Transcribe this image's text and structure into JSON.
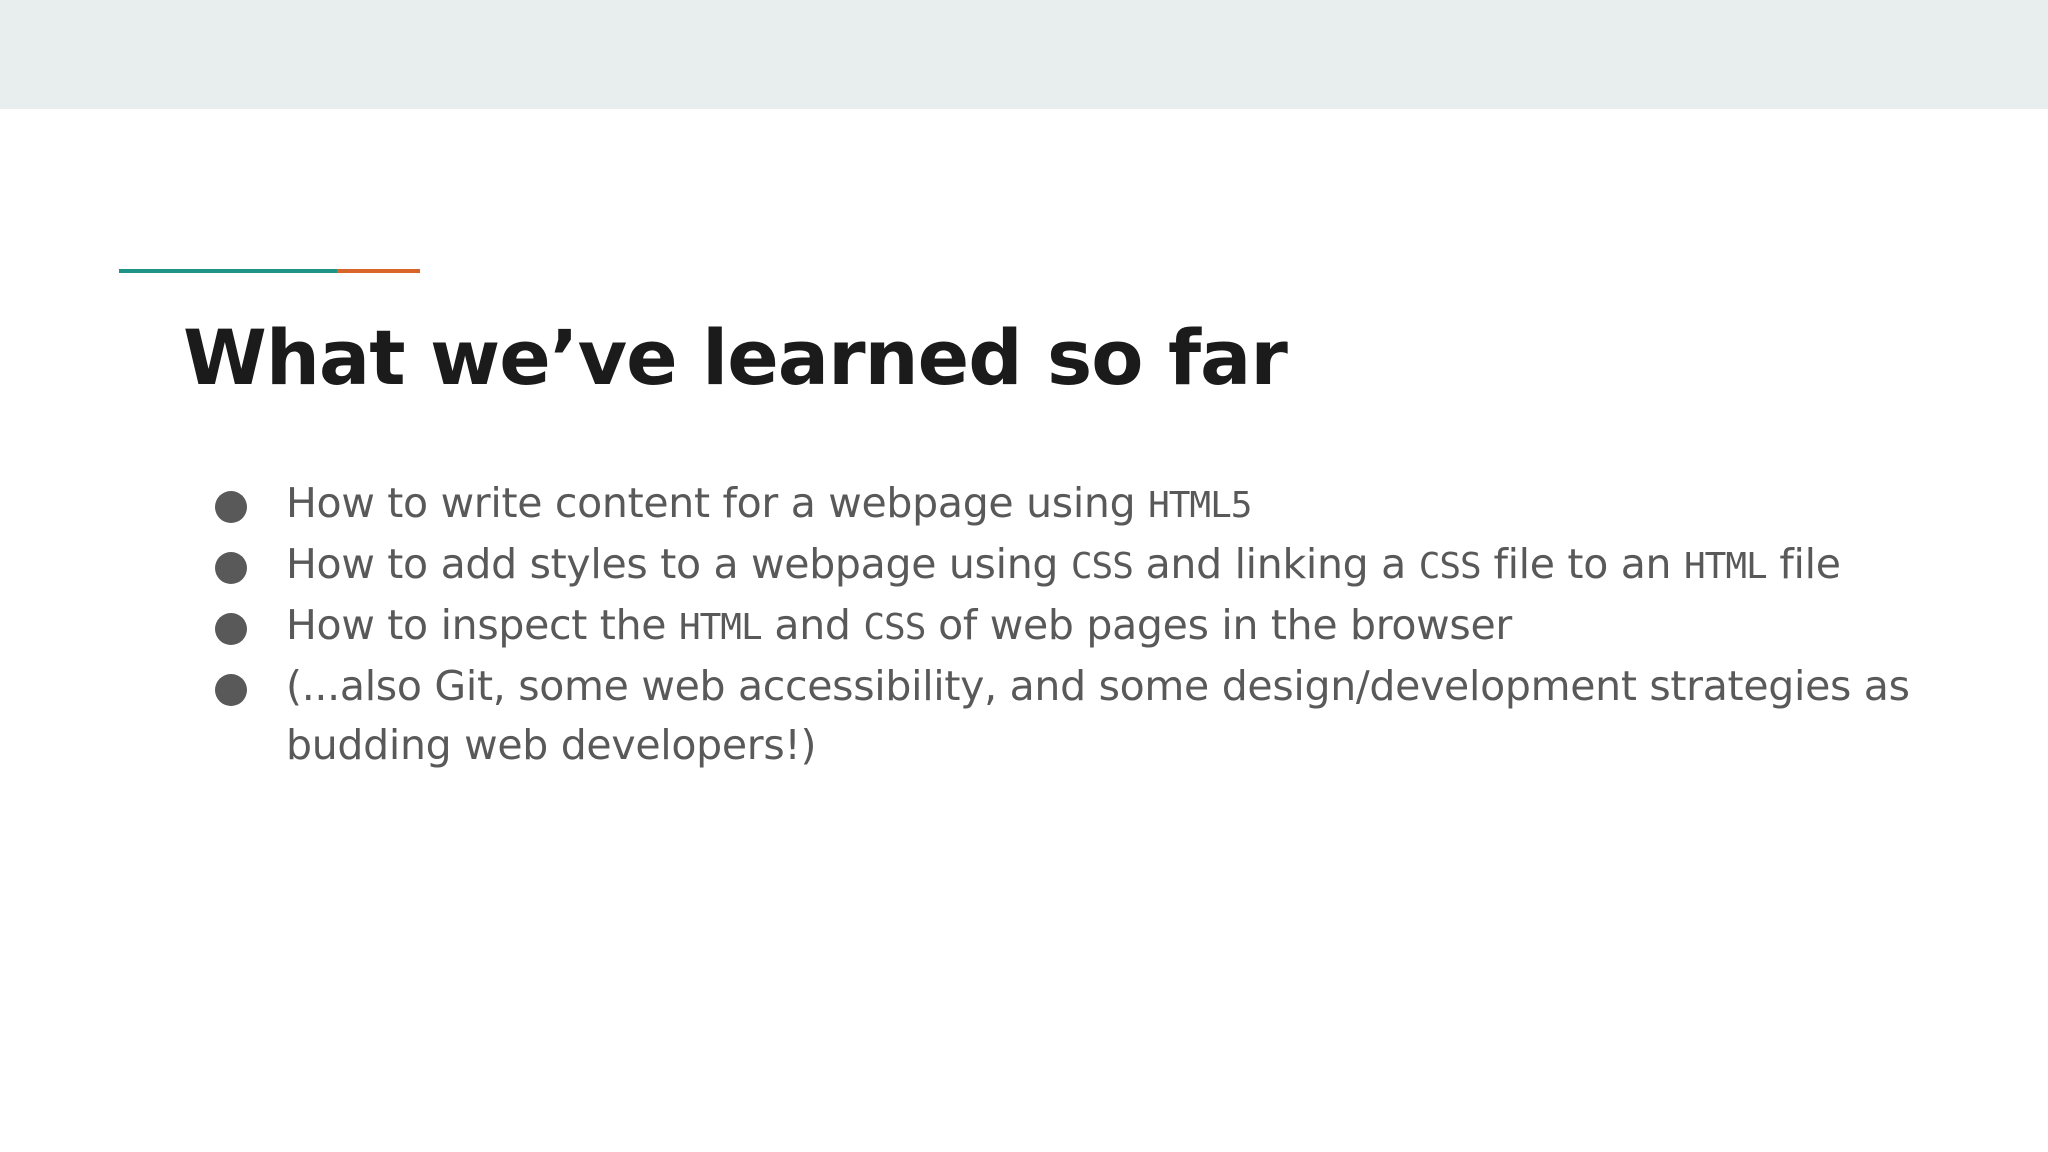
{
  "colors": {
    "top_band": "#e8eeee",
    "accent_teal": "#1e9488",
    "accent_orange": "#d9642a",
    "title": "#1b1b1b",
    "body_text": "#595959"
  },
  "slide": {
    "title": "What we’ve learned so far",
    "bullets": [
      {
        "parts": [
          {
            "text": "How to write content for a webpage using ",
            "code": false
          },
          {
            "text": "HTML5",
            "code": true
          }
        ]
      },
      {
        "parts": [
          {
            "text": "How to add styles to a webpage using ",
            "code": false
          },
          {
            "text": "CSS",
            "code": true
          },
          {
            "text": " and linking a ",
            "code": false
          },
          {
            "text": "CSS",
            "code": true
          },
          {
            "text": " file to an ",
            "code": false
          },
          {
            "text": "HTML",
            "code": true
          },
          {
            "text": " file",
            "code": false
          }
        ]
      },
      {
        "parts": [
          {
            "text": "How to inspect the ",
            "code": false
          },
          {
            "text": "HTML",
            "code": true
          },
          {
            "text": " and ",
            "code": false
          },
          {
            "text": "CSS",
            "code": true
          },
          {
            "text": " of web pages in the browser",
            "code": false
          }
        ]
      },
      {
        "parts": [
          {
            "text": "(...also Git, some web accessibility, and some design/development strategies as budding web developers!)",
            "code": false
          }
        ]
      }
    ]
  }
}
